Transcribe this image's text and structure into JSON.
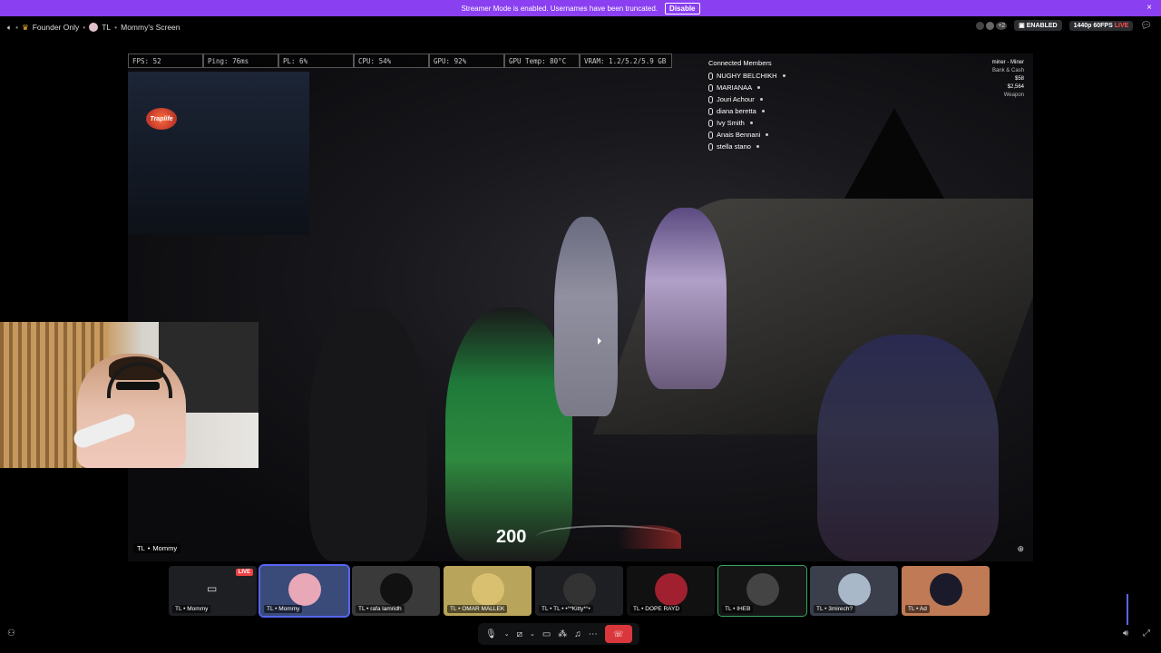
{
  "banner": {
    "text": "Streamer Mode is enabled. Usernames have been truncated.",
    "button": "Disable",
    "close": "×"
  },
  "topbar": {
    "server": "Founder Only",
    "channel_prefix": "TL",
    "channel": "Mommy's Screen",
    "status_enabled": "ENABLED",
    "stream_quality": "1440p 60FPS",
    "live": "LIVE",
    "viewer_count": "+2"
  },
  "stats": [
    "FPS: 52",
    "Ping: 76ms",
    "PL: 6%",
    "CPU: 54%",
    "GPU: 92%",
    "GPU Temp: 80°C",
    "VRAM: 1.2/5.2/5.9 GB"
  ],
  "members": {
    "heading": "Connected Members",
    "list": [
      "NUGHY BELCHIKH",
      "MARIANAA",
      "Jouri Achour",
      "diana beretta",
      "Ivy Smith",
      "Anais Bennani",
      "stella stano"
    ]
  },
  "hud": {
    "line1": "miner - Miner",
    "line2": "Bank & Cash",
    "bank": "$58",
    "cash": "$2,564",
    "line5": "Weapon"
  },
  "logo": "Traplife",
  "speedometer": "200",
  "video_label": {
    "prefix": "TL",
    "name": "Mommy"
  },
  "tiles": [
    {
      "prefix": "TL",
      "name": "Mommy",
      "live": "LIVE",
      "bg": "#1e1f22"
    },
    {
      "prefix": "TL",
      "name": "Mommy",
      "bg": "#3a4b7a",
      "avatar": "#e8a8b8"
    },
    {
      "prefix": "TL",
      "name": "rafa lamridh",
      "bg": "#3a3a3a",
      "avatar": "#111"
    },
    {
      "prefix": "TL",
      "name": "OMAR MALLEK",
      "bg": "#b8a45a",
      "avatar": "#d8c070"
    },
    {
      "prefix": "TL • TL",
      "name": "•°*Kitty*°•",
      "bg": "#1e1f22",
      "avatar": "#333"
    },
    {
      "prefix": "TL",
      "name": "DOPE RAYD",
      "bg": "#111",
      "avatar": "#a02030"
    },
    {
      "prefix": "TL",
      "name": "IHEB",
      "bg": "#151515",
      "avatar": "#444"
    },
    {
      "prefix": "TL",
      "name": "3mirech?",
      "bg": "#3a3f4b",
      "avatar": "#a8b8c8"
    },
    {
      "prefix": "TL",
      "name": "Ad",
      "bg": "#c07a55",
      "avatar": "#1a1a2a"
    }
  ],
  "icons": {
    "speaker": "speaker-icon",
    "crown": "crown-icon",
    "mic": "microphone-icon",
    "camera": "camera-icon",
    "screen": "screen-share-icon",
    "activities": "activities-icon",
    "soundboard": "soundboard-icon",
    "more": "more-icon",
    "disconnect": "disconnect-icon",
    "fullscreen": "fullscreen-icon",
    "volume": "volume-icon",
    "search": "zoom-icon",
    "invite": "invite-icon",
    "chat": "chat-icon"
  },
  "colors": {
    "banner": "#8a3ff0",
    "accent": "#5865f2",
    "live": "#ed4245",
    "speaking": "#3ba55d"
  }
}
